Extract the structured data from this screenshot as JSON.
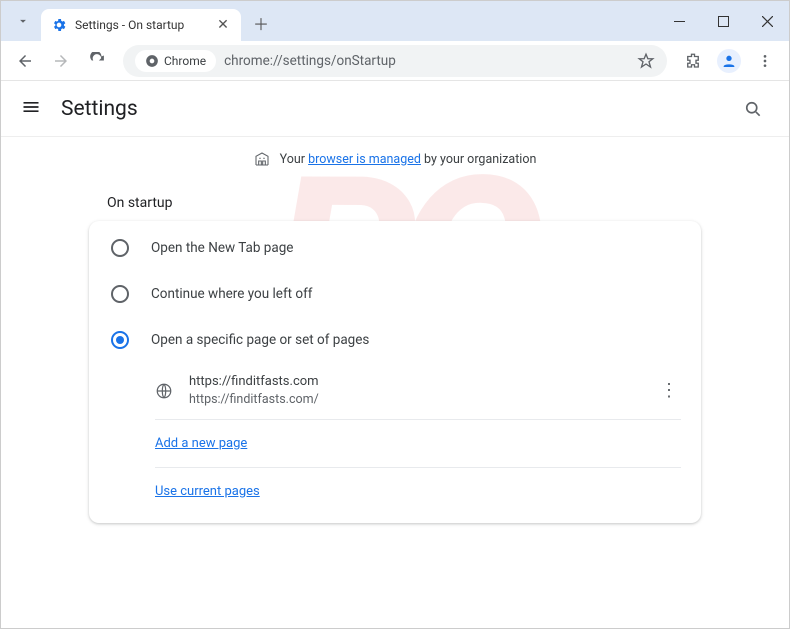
{
  "tab": {
    "title": "Settings - On startup"
  },
  "omnibox": {
    "chip": "Chrome",
    "url": "chrome://settings/onStartup"
  },
  "header": {
    "title": "Settings"
  },
  "managed": {
    "prefix": "Your ",
    "link": "browser is managed",
    "suffix": " by your organization"
  },
  "section": {
    "title": "On startup"
  },
  "radios": {
    "r1": "Open the New Tab page",
    "r2": "Continue where you left off",
    "r3": "Open a specific page or set of pages"
  },
  "page": {
    "title": "https://finditfasts.com",
    "url": "https://finditfasts.com/"
  },
  "links": {
    "add": "Add a new page",
    "current": "Use current pages"
  }
}
